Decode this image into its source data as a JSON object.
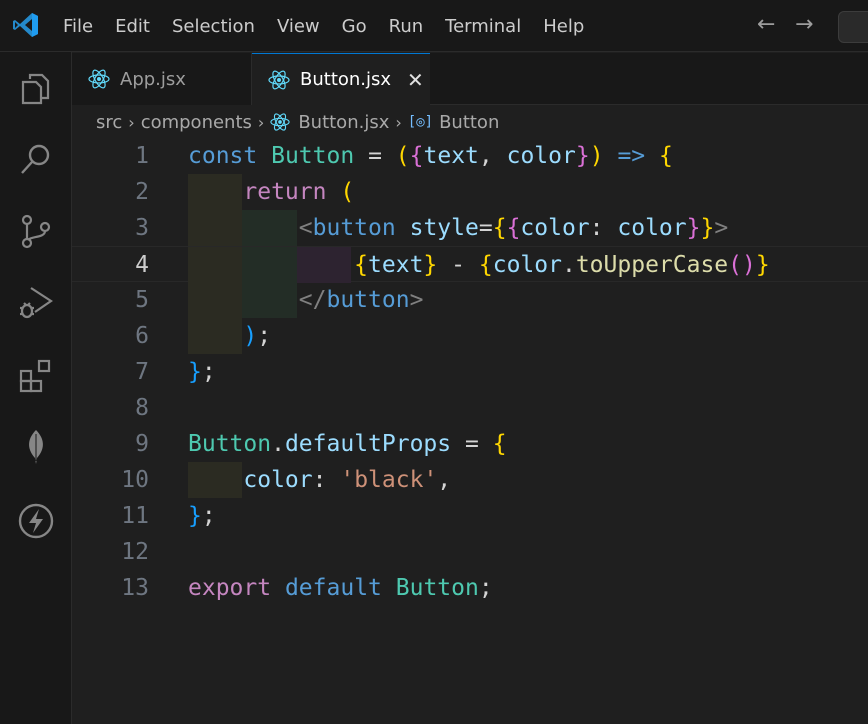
{
  "menu": [
    "File",
    "Edit",
    "Selection",
    "View",
    "Go",
    "Run",
    "Terminal",
    "Help"
  ],
  "nav": {
    "back": "←",
    "forward": "→"
  },
  "activity_icons": [
    "explorer-icon",
    "search-icon",
    "source-control-icon",
    "run-debug-icon",
    "extensions-icon",
    "mongodb-leaf-icon",
    "thunder-client-icon"
  ],
  "tabs": [
    {
      "label": "App.jsx",
      "active": false
    },
    {
      "label": "Button.jsx",
      "active": true,
      "close": "✕"
    }
  ],
  "breadcrumb": {
    "segments": [
      "src",
      "components",
      "Button.jsx",
      "Button"
    ],
    "separator": "›"
  },
  "editor": {
    "current_line": 4,
    "lines": [
      {
        "n": "1",
        "text": "const Button = ({text, color}) => {"
      },
      {
        "n": "2",
        "text": "    return ("
      },
      {
        "n": "3",
        "text": "        <button style={{color: color}}>"
      },
      {
        "n": "4",
        "text": "            {text} - {color.toUpperCase()}"
      },
      {
        "n": "5",
        "text": "        </button>"
      },
      {
        "n": "6",
        "text": "    );"
      },
      {
        "n": "7",
        "text": "};"
      },
      {
        "n": "8",
        "text": ""
      },
      {
        "n": "9",
        "text": "Button.defaultProps = {"
      },
      {
        "n": "10",
        "text": "    color: 'black',"
      },
      {
        "n": "11",
        "text": "};"
      },
      {
        "n": "12",
        "text": ""
      },
      {
        "n": "13",
        "text": "export default Button;"
      }
    ]
  },
  "colors": {
    "background": "#1f1f1f",
    "accent": "#0078d4",
    "react": "#61dafb",
    "keyword": "#569cd6",
    "control": "#c586c0",
    "string": "#ce9178",
    "bracket_gold": "#ffd700"
  }
}
